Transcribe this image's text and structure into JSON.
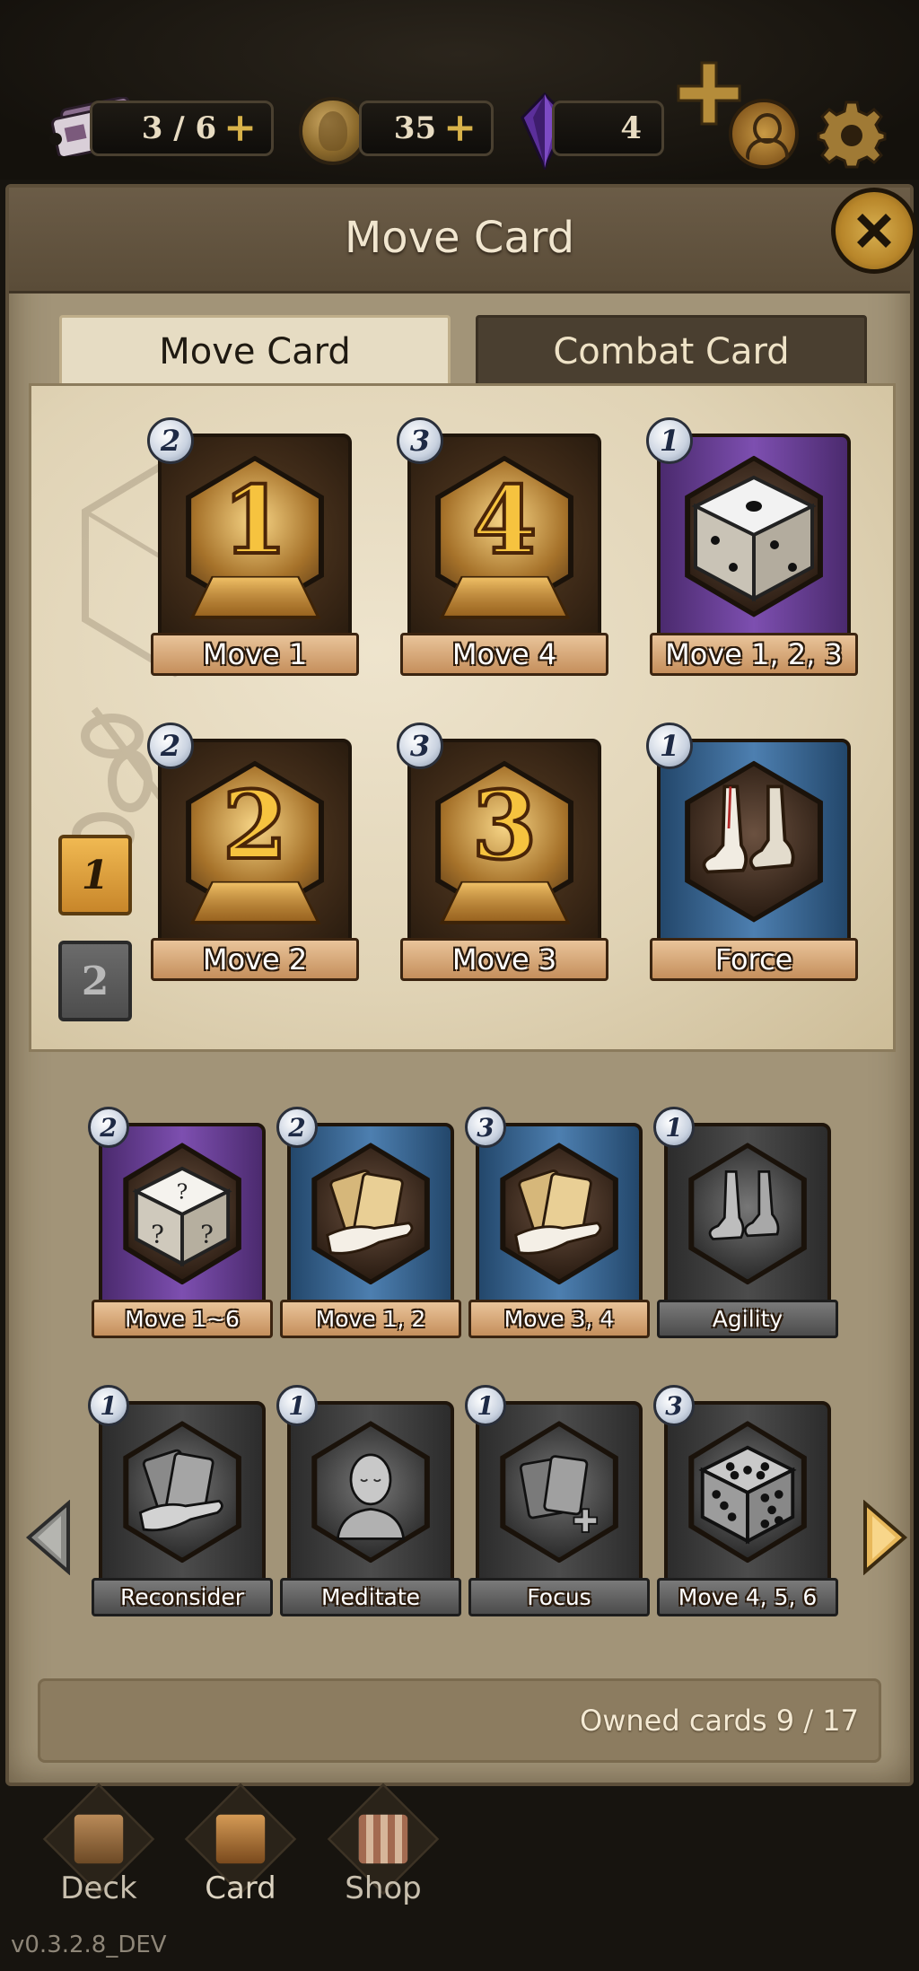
{
  "resources": {
    "tickets": "3 / 6",
    "coins": "35",
    "gems": "4",
    "plus_glyph": "+"
  },
  "panel": {
    "title": "Move Card",
    "close_icon": "close-icon"
  },
  "tabs": [
    {
      "label": "Move Card",
      "active": true
    },
    {
      "label": "Combat Card",
      "active": false
    }
  ],
  "deck": {
    "pages": [
      "1",
      "2"
    ],
    "active_page": "1",
    "cards": [
      {
        "label": "Move 1",
        "count": "2",
        "style": "gold",
        "art": "number",
        "number": "1"
      },
      {
        "label": "Move 4",
        "count": "3",
        "style": "gold",
        "art": "number",
        "number": "4"
      },
      {
        "label": "Move 1, 2, 3",
        "count": "1",
        "style": "purple",
        "art": "dice-one-icon"
      },
      {
        "label": "Move 2",
        "count": "2",
        "style": "gold",
        "art": "number",
        "number": "2"
      },
      {
        "label": "Move 3",
        "count": "3",
        "style": "gold",
        "art": "number",
        "number": "3"
      },
      {
        "label": "Force",
        "count": "1",
        "style": "blue",
        "art": "feet-icon"
      }
    ]
  },
  "collection": {
    "cards": [
      {
        "label": "Move 1~6",
        "count": "2",
        "style": "purple",
        "art": "mystery-dice-icon"
      },
      {
        "label": "Move 1, 2",
        "count": "2",
        "style": "blue",
        "art": "hand-cards-icon"
      },
      {
        "label": "Move 3, 4",
        "count": "3",
        "style": "blue",
        "art": "hand-cards-icon"
      },
      {
        "label": "Agility",
        "count": "1",
        "style": "grey",
        "art": "feet-icon"
      },
      {
        "label": "Reconsider",
        "count": "1",
        "style": "grey",
        "art": "hand-cards-icon"
      },
      {
        "label": "Meditate",
        "count": "1",
        "style": "grey",
        "art": "meditate-head-icon"
      },
      {
        "label": "Focus",
        "count": "1",
        "style": "grey",
        "art": "cards-plus-icon"
      },
      {
        "label": "Move 4, 5, 6",
        "count": "3",
        "style": "grey",
        "art": "dice-five-icon"
      }
    ],
    "owned": "Owned cards 9 / 17"
  },
  "nav": [
    {
      "label": "Deck",
      "icon": "deck-icon"
    },
    {
      "label": "Card",
      "icon": "card-icon"
    },
    {
      "label": "Shop",
      "icon": "shop-icon"
    }
  ],
  "version": "v0.3.2.8_DEV",
  "colors": {
    "panel_bg": "#a29478",
    "accent_gold": "#d8b24a",
    "active_page": "#e8a845",
    "gem_purple": "#5b2f9a"
  }
}
